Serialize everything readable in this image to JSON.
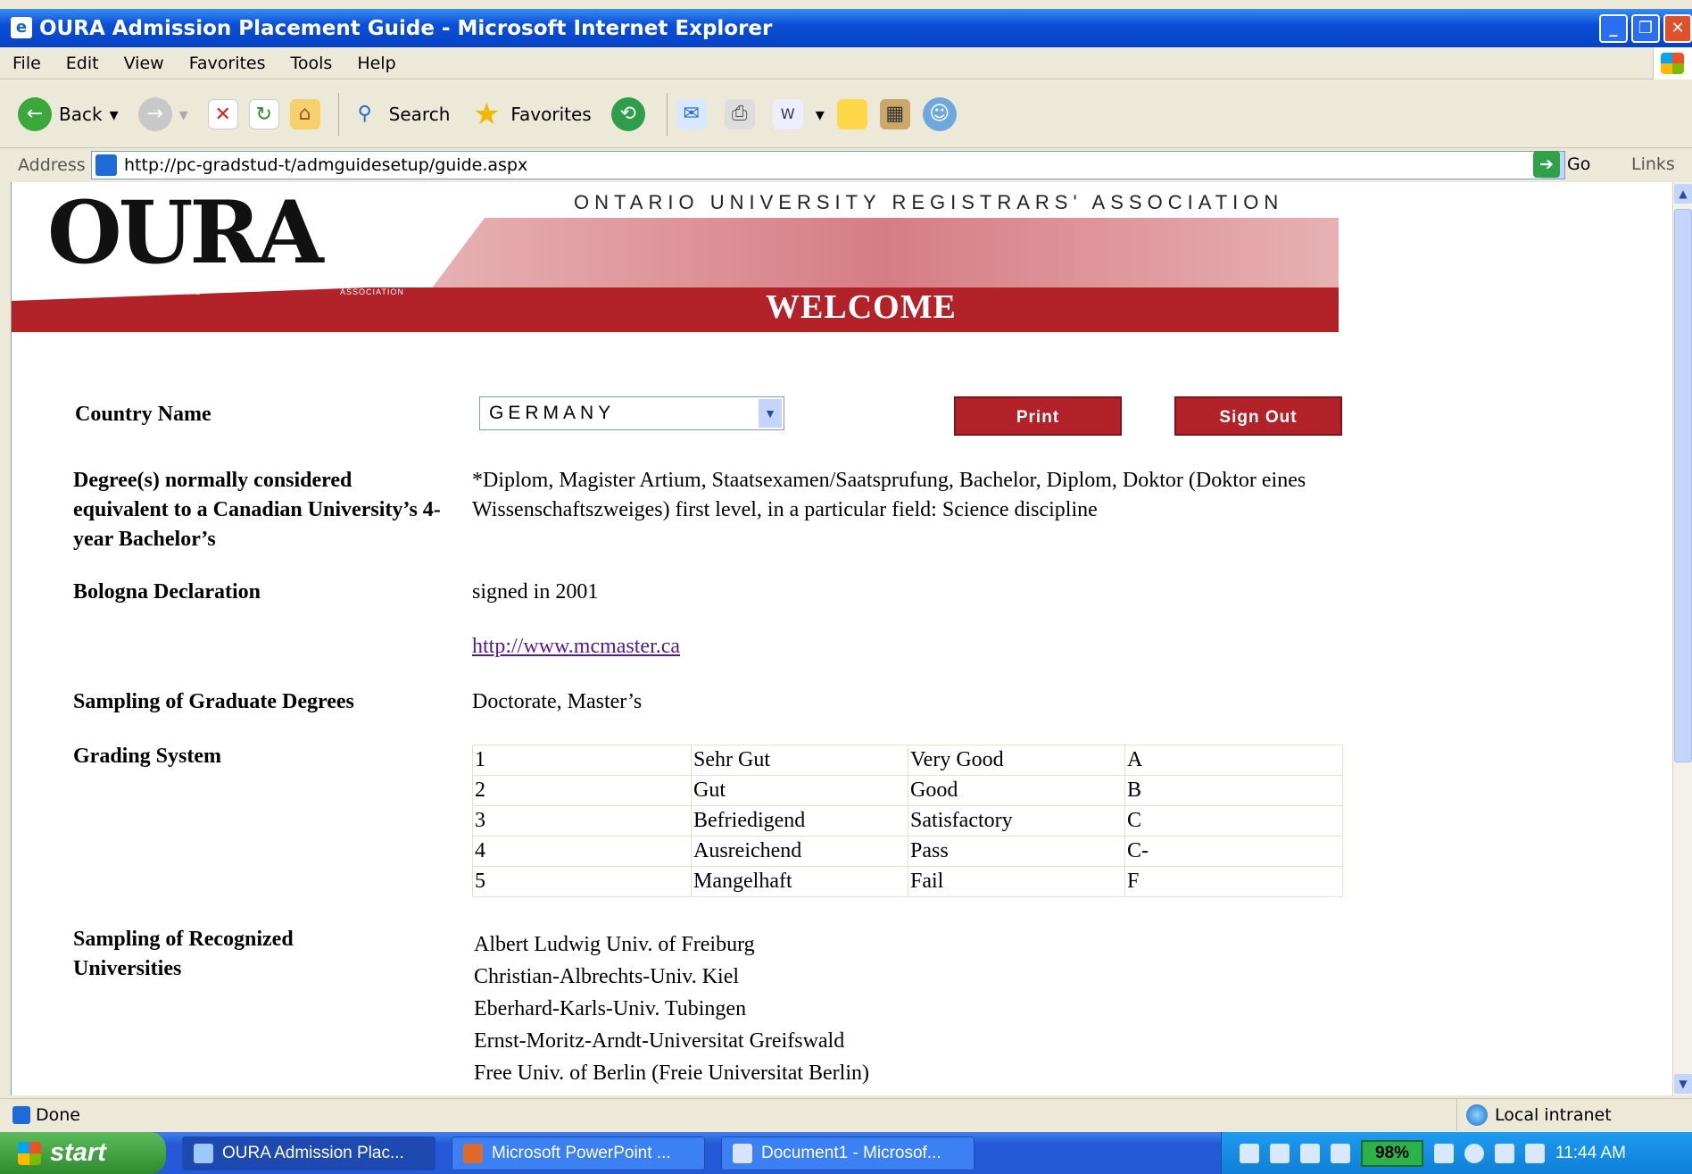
{
  "window": {
    "title": "OURA Admission Placement Guide - Microsoft Internet Explorer"
  },
  "menu": [
    "File",
    "Edit",
    "View",
    "Favorites",
    "Tools",
    "Help"
  ],
  "toolbar": {
    "back": "Back",
    "search": "Search",
    "favorites": "Favorites"
  },
  "address": {
    "label": "Address",
    "url": "http://pc-gradstud-t/admguidesetup/guide.aspx",
    "go": "Go",
    "links": "Links"
  },
  "banner": {
    "logo": "OURA",
    "org": "ONTARIO UNIVERSITY REGISTRARS' ASSOCIATION",
    "logo_small_left": "ONTARIO UNIVERSITY REGISTRARS'",
    "logo_small_right": "ASSOCIATION",
    "welcome": "WELCOME"
  },
  "form": {
    "country_label": "Country Name",
    "country_value": "GERMANY",
    "print_label": "Print",
    "signout_label": "Sign Out",
    "degree_label": "Degree(s) normally considered equivalent to a Canadian University’s 4-year Bachelor’s",
    "degree_value": "*Diplom, Magister Artium, Staatsexamen/Saatsprufung, Bachelor, Diplom, Doktor (Doktor eines Wissenschaftszweiges) first level, in a particular field: Science discipline",
    "bologna_label": "Bologna Declaration",
    "bologna_value": "signed in 2001",
    "link": "http://www.mcmaster.ca",
    "grad_label": "Sampling of Graduate Degrees",
    "grad_value": "Doctorate, Master’s",
    "grading_label": "Grading System",
    "grading": [
      [
        "1",
        "Sehr Gut",
        "Very Good",
        "A"
      ],
      [
        "2",
        "Gut",
        "Good",
        "B"
      ],
      [
        "3",
        "Befriedigend",
        "Satisfactory",
        "C"
      ],
      [
        "4",
        "Ausreichend",
        "Pass",
        "C-"
      ],
      [
        "5",
        "Mangelhaft",
        "Fail",
        "F"
      ]
    ],
    "unis_label": "Sampling of Recognized Universities",
    "unis": [
      "Albert Ludwig Univ. of Freiburg",
      "Christian-Albrechts-Univ. Kiel",
      "Eberhard-Karls-Univ. Tubingen",
      "Ernst-Moritz-Arndt-Universitat Greifswald",
      "Free Univ. of Berlin (Freie Universitat Berlin)"
    ]
  },
  "status": {
    "text": "Done",
    "zone": "Local intranet"
  },
  "taskbar": {
    "start": "start",
    "tasks": [
      "OURA Admission Plac...",
      "Microsoft PowerPoint ...",
      "Document1 - Microsof..."
    ],
    "battery": "98%",
    "time": "11:44 AM"
  }
}
